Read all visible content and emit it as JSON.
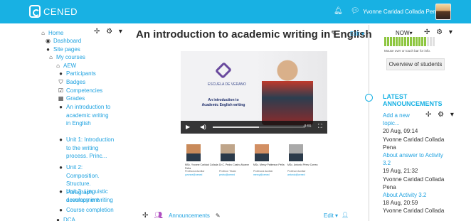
{
  "header": {
    "logo_text": "CENED",
    "user_name": "Yvonne Caridad Collada Pena",
    "icons": [
      "bell-icon",
      "chat-icon"
    ]
  },
  "navigation": {
    "controls": "✢ ⚙ ▾",
    "items": [
      {
        "label": "Home",
        "icon": "home-icon",
        "dark": false
      },
      {
        "label": "Dashboard",
        "icon": "dashboard-icon",
        "dark": false
      },
      {
        "label": "Site pages",
        "icon": "circle-icon",
        "dark": false
      },
      {
        "label": "My courses",
        "icon": "courses-icon",
        "dark": false
      },
      {
        "label": "AEW",
        "icon": "course-icon",
        "dark": false
      },
      {
        "label": "Participants",
        "icon": "circle-icon",
        "dark": false
      },
      {
        "label": "Badges",
        "icon": "badge-icon",
        "dark": false
      },
      {
        "label": "Competencies",
        "icon": "competencies-icon",
        "dark": false
      },
      {
        "label": "Grades",
        "icon": "grades-icon",
        "dark": false
      },
      {
        "label": "An introduction to academic writing in English",
        "icon": "circle-icon",
        "dark": false
      },
      {
        "label": "Unit 1: Introduction to the writing process. Princ...",
        "icon": "circle-icon",
        "dark": false
      },
      {
        "label": "Unit 2: Composition. Structure. Paragraph development",
        "icon": "circle-icon",
        "dark": false
      },
      {
        "label": "Unit 3: Linguistic accuracy in writing",
        "icon": "circle-icon",
        "dark": false
      },
      {
        "label": "Course completion",
        "icon": "circle-icon",
        "dark": false
      },
      {
        "label": "DCA",
        "icon": "circle-icon",
        "dark": false
      }
    ]
  },
  "main": {
    "title": "An introduction to academic writing in English",
    "edit_label": "Edit ▾",
    "video": {
      "school_label": "ESCUELA DE VERANO",
      "caption_line1": "An introduction to",
      "caption_line2": "Academic English writing",
      "time": "-8:55",
      "progress": 0.5
    },
    "teachers": [
      {
        "name": "MSc. Yvonne Caridad Collada Peña",
        "role": "Profesora Auxiliar",
        "email": "yvonne@cened"
      },
      {
        "name": "Dr.C. Pedro Castro Alvarez",
        "role": "Profesor Titular",
        "email": "pedro@cened"
      },
      {
        "name": "MSc. Mercy Patterson Peña",
        "role": "Profesora Auxiliar",
        "email": "mercy@cened"
      },
      {
        "name": "MSc. Antonio Pérez Correa",
        "role": "Profesor Auxiliar",
        "email": "antonio@cened"
      }
    ],
    "bottom": {
      "announcements_label": "Announcements",
      "edit_label": "Edit ▾"
    }
  },
  "right": {
    "now_label": "NOW",
    "controls": "✢ ⚙ ▾",
    "progress_blocks": 18,
    "progress_done": 15,
    "progress_hint": "Mouse over or touch bar for info.",
    "overview_button": "Overview of students",
    "announcements": {
      "title": "LATEST ANNOUNCEMENTS",
      "controls": "✢ ⚙ ▾",
      "lines": [
        {
          "text": "Add a new",
          "type": "link"
        },
        {
          "text": "topic...",
          "type": "link"
        },
        {
          "text": "20 Aug, 09:14",
          "type": "plain"
        },
        {
          "text": "Yvonne Caridad Collada",
          "type": "plain"
        },
        {
          "text": "Pena",
          "type": "plain"
        },
        {
          "text": "About answer to Activity",
          "type": "link"
        },
        {
          "text": "3.2",
          "type": "link"
        },
        {
          "text": "19 Aug, 21:32",
          "type": "plain"
        },
        {
          "text": "Yvonne Caridad Collada",
          "type": "plain"
        },
        {
          "text": "Pena",
          "type": "plain"
        },
        {
          "text": "About Activity 3.2",
          "type": "link"
        },
        {
          "text": "18 Aug, 20:59",
          "type": "plain"
        },
        {
          "text": "Yvonne Caridad Collada",
          "type": "plain"
        }
      ]
    }
  }
}
